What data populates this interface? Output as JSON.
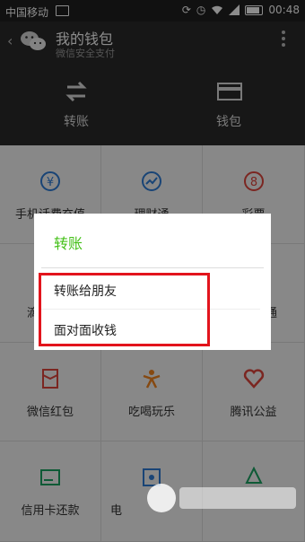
{
  "status_bar": {
    "carrier": "中国移动",
    "time": "00:48"
  },
  "header": {
    "title": "我的钱包",
    "subtitle": "微信安全支付"
  },
  "top_nav": [
    {
      "label": "转账",
      "icon": "transfer-icon"
    },
    {
      "label": "钱包",
      "icon": "wallet-card-icon"
    }
  ],
  "grid": [
    {
      "label": "手机话费充值",
      "icon": "yen-icon",
      "color": "#2f7dd8"
    },
    {
      "label": "理财通",
      "icon": "chart-up-icon",
      "color": "#2f7dd8"
    },
    {
      "label": "彩票",
      "icon": "lottery-8-icon",
      "color": "#e0463c"
    },
    {
      "label": "滴",
      "icon": "hidden-icon",
      "color": "#999999"
    },
    {
      "label": "",
      "icon": "hidden-icon",
      "color": "#999999"
    },
    {
      "label": "通",
      "icon": "hidden-icon",
      "color": "#999999"
    },
    {
      "label": "微信红包",
      "icon": "red-packet-icon",
      "color": "#e0463c"
    },
    {
      "label": "吃喝玩乐",
      "icon": "person-jump-icon",
      "color": "#f5861f"
    },
    {
      "label": "腾讯公益",
      "icon": "heart-icon",
      "color": "#e0463c"
    },
    {
      "label": "信用卡还款",
      "icon": "credit-card-icon",
      "color": "#1aa463"
    },
    {
      "label": "电",
      "icon": "film-icon",
      "color": "#2f7dd8"
    },
    {
      "label": "",
      "icon": "tree-icon",
      "color": "#1aa463"
    }
  ],
  "dialog": {
    "title": "转账",
    "options": [
      "转账给朋友",
      "面对面收钱"
    ]
  },
  "colors": {
    "accent": "#45c01a",
    "highlight": "#e2141c"
  }
}
